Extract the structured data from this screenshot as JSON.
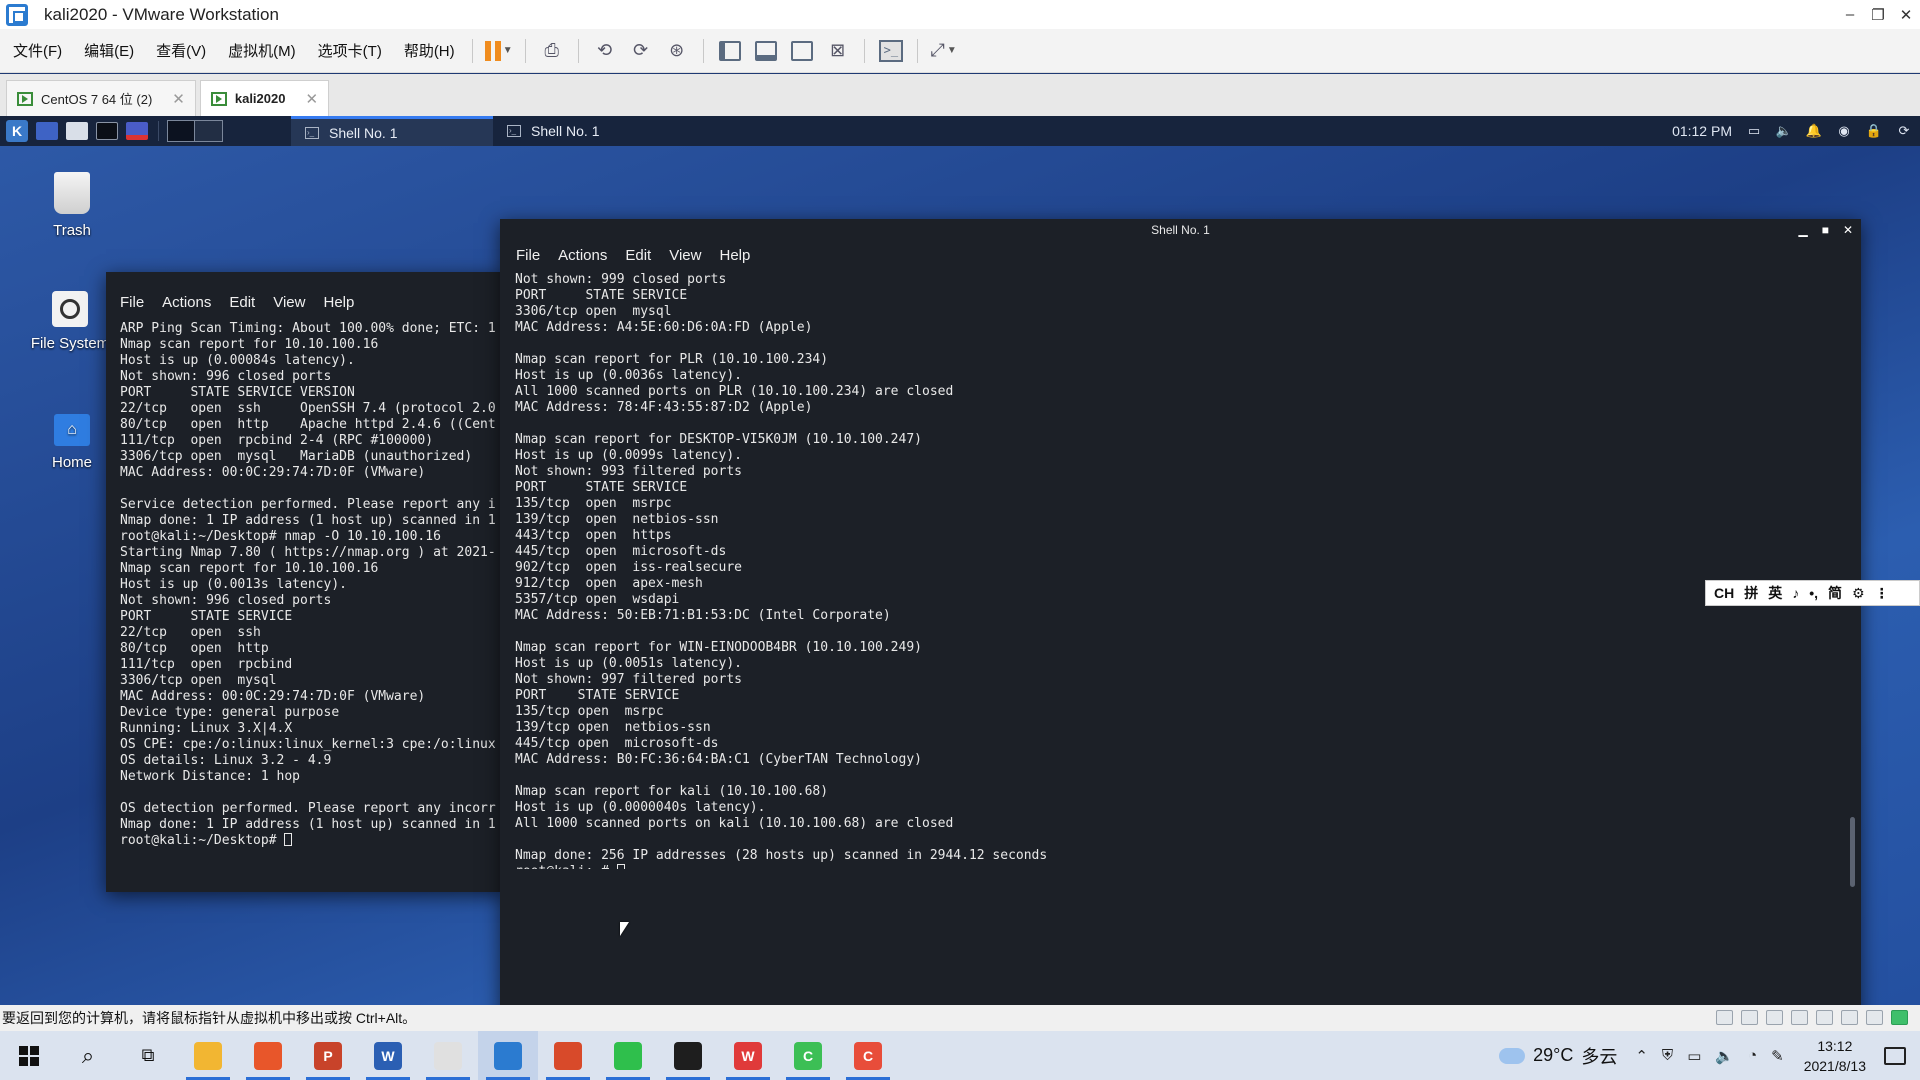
{
  "vm_window": {
    "title": "kali2020 - VMware Workstation",
    "minimize": "–",
    "maximize": "❐",
    "close": "✕"
  },
  "vm_menu": [
    "文件(F)",
    "编辑(E)",
    "查看(V)",
    "虚拟机(M)",
    "选项卡(T)",
    "帮助(H)"
  ],
  "vm_tabs": [
    {
      "label": "CentOS 7 64 位 (2)",
      "close": "✕"
    },
    {
      "label": "kali2020",
      "close": "✕"
    }
  ],
  "kali_panel": {
    "tasks": [
      "Shell No. 1",
      "Shell No. 1"
    ],
    "time": "01:12 PM"
  },
  "desktop_icons": [
    {
      "label": "Trash"
    },
    {
      "label": "File System"
    },
    {
      "label": "Home"
    }
  ],
  "terminal_back": {
    "menu": [
      "File",
      "Actions",
      "Edit",
      "View",
      "Help"
    ],
    "output": "ARP Ping Scan Timing: About 100.00% done; ETC: 1\nNmap scan report for 10.10.100.16\nHost is up (0.00084s latency).\nNot shown: 996 closed ports\nPORT     STATE SERVICE VERSION\n22/tcp   open  ssh     OpenSSH 7.4 (protocol 2.0\n80/tcp   open  http    Apache httpd 2.4.6 ((Cent\n111/tcp  open  rpcbind 2-4 (RPC #100000)\n3306/tcp open  mysql   MariaDB (unauthorized)\nMAC Address: 00:0C:29:74:7D:0F (VMware)\n\nService detection performed. Please report any i\nNmap done: 1 IP address (1 host up) scanned in 1\nroot@kali:~/Desktop# nmap -O 10.10.100.16\nStarting Nmap 7.80 ( https://nmap.org ) at 2021-\nNmap scan report for 10.10.100.16\nHost is up (0.0013s latency).\nNot shown: 996 closed ports\nPORT     STATE SERVICE\n22/tcp   open  ssh\n80/tcp   open  http\n111/tcp  open  rpcbind\n3306/tcp open  mysql\nMAC Address: 00:0C:29:74:7D:0F (VMware)\nDevice type: general purpose\nRunning: Linux 3.X|4.X\nOS CPE: cpe:/o:linux:linux_kernel:3 cpe:/o:linux\nOS details: Linux 3.2 - 4.9\nNetwork Distance: 1 hop\n\nOS detection performed. Please report any incorr\nNmap done: 1 IP address (1 host up) scanned in 1\nroot@kali:~/Desktop# "
  },
  "terminal_front": {
    "title": "Shell No. 1",
    "menu": [
      "File",
      "Actions",
      "Edit",
      "View",
      "Help"
    ],
    "output": "Not shown: 999 closed ports\nPORT     STATE SERVICE\n3306/tcp open  mysql\nMAC Address: A4:5E:60:D6:0A:FD (Apple)\n\nNmap scan report for PLR (10.10.100.234)\nHost is up (0.0036s latency).\nAll 1000 scanned ports on PLR (10.10.100.234) are closed\nMAC Address: 78:4F:43:55:87:D2 (Apple)\n\nNmap scan report for DESKTOP-VI5K0JM (10.10.100.247)\nHost is up (0.0099s latency).\nNot shown: 993 filtered ports\nPORT     STATE SERVICE\n135/tcp  open  msrpc\n139/tcp  open  netbios-ssn\n443/tcp  open  https\n445/tcp  open  microsoft-ds\n902/tcp  open  iss-realsecure\n912/tcp  open  apex-mesh\n5357/tcp open  wsdapi\nMAC Address: 50:EB:71:B1:53:DC (Intel Corporate)\n\nNmap scan report for WIN-EINODOOB4BR (10.10.100.249)\nHost is up (0.0051s latency).\nNot shown: 997 filtered ports\nPORT    STATE SERVICE\n135/tcp open  msrpc\n139/tcp open  netbios-ssn\n445/tcp open  microsoft-ds\nMAC Address: B0:FC:36:64:BA:C1 (CyberTAN Technology)\n\nNmap scan report for kali (10.10.100.68)\nHost is up (0.0000040s latency).\nAll 1000 scanned ports on kali (10.10.100.68) are closed\n\nNmap done: 256 IP addresses (28 hosts up) scanned in 2944.12 seconds\nroot@kali:~# "
  },
  "ime_bar": [
    "CH",
    "拼",
    "英",
    "♪",
    "•,",
    "简",
    "⚙",
    "⋮"
  ],
  "vm_status": {
    "hint": "要返回到您的计算机，请将鼠标指针从虚拟机中移出或按 Ctrl+Alt。"
  },
  "taskbar": {
    "apps": [
      {
        "name": "File Explorer",
        "glyph": "",
        "color": "#f2b632"
      },
      {
        "name": "Firefox",
        "glyph": "",
        "color": "#e8562a"
      },
      {
        "name": "PowerPoint",
        "glyph": "P",
        "color": "#c8432a"
      },
      {
        "name": "Word",
        "glyph": "W",
        "color": "#2b5fb3"
      },
      {
        "name": "Java",
        "glyph": "",
        "color": "#e0e0e0"
      },
      {
        "name": "VMware Workstation",
        "glyph": "",
        "color": "#2b7bd0"
      },
      {
        "name": "Office",
        "glyph": "",
        "color": "#d84a2a"
      },
      {
        "name": "WeChat",
        "glyph": "",
        "color": "#2fbf4c"
      },
      {
        "name": "Terminal",
        "glyph": "",
        "color": "#1e1e1e"
      },
      {
        "name": "WPS",
        "glyph": "W",
        "color": "#e03a3a"
      },
      {
        "name": "App Green",
        "glyph": "C",
        "color": "#3cbf55"
      },
      {
        "name": "App Red",
        "glyph": "C",
        "color": "#e84d3a"
      }
    ],
    "weather_temp": "29°C",
    "weather_desc": "多云",
    "time": "13:12",
    "date": "2021/8/13"
  },
  "colors": {
    "kali_accent": "#367bf0",
    "terminal_bg": "#1c2027",
    "vm_pause": "#f08c1e"
  }
}
